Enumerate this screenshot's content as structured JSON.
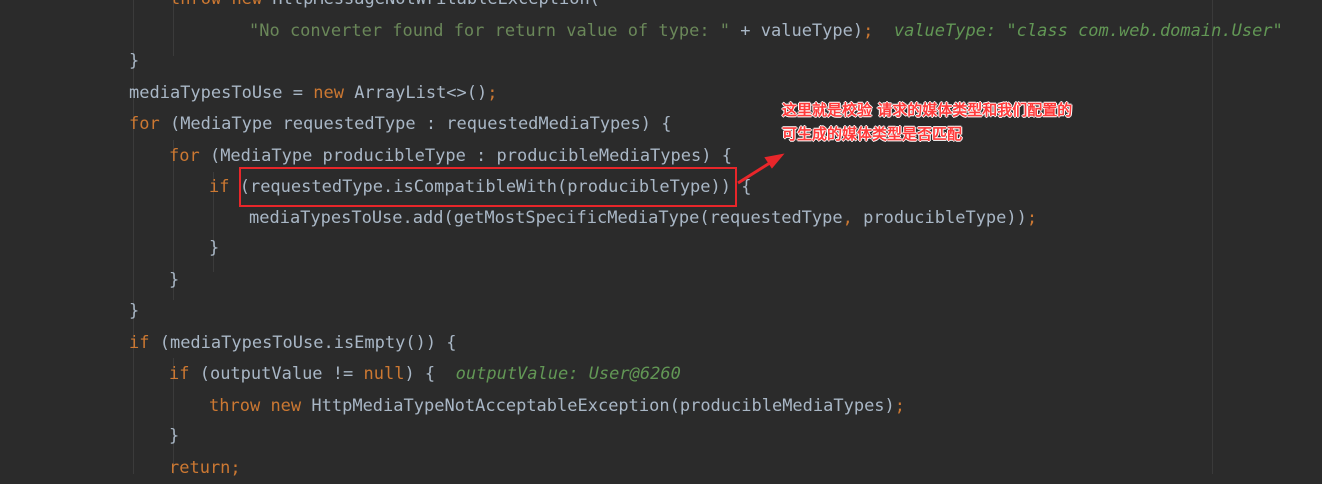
{
  "code": {
    "l0": {
      "kw1": "throw",
      "kw2": "new",
      "cls": "HttpMessageNotWritableException("
    },
    "l1": {
      "str": "\"No converter found for return value of type: \"",
      "plus": " + valueType)",
      "semi": ";",
      "hint": "valueType: \"class com.web.domain.User\""
    },
    "l2": {
      "brace": "}"
    },
    "l3": {
      "pre": "mediaTypesToUse = ",
      "kw": "new",
      "post": " ArrayList<>()",
      "semi": ";"
    },
    "l4": {
      "kw": "for",
      "rest": " (MediaType requestedType : requestedMediaTypes) {"
    },
    "l5": {
      "kw": "for",
      "rest": " (MediaType producibleType : producibleMediaTypes) {"
    },
    "l6": {
      "kw": "if",
      "rest": " (requestedType.isCompatibleWith(producibleType)) {"
    },
    "l7": {
      "pre": "mediaTypesToUse.add(getMostSpecificMediaType(requestedType",
      "comma": ",",
      "post": " producibleType))",
      "semi": ";"
    },
    "l8": {
      "brace": "}"
    },
    "l9": {
      "brace": "}"
    },
    "l10": {
      "brace": "}"
    },
    "l11": {
      "kw": "if",
      "rest": " (mediaTypesToUse.isEmpty()) {"
    },
    "l12": {
      "kw": "if",
      "pre": " (outputValue != ",
      "nul": "null",
      "post": ") {",
      "hint": "outputValue: User@6260"
    },
    "l13": {
      "kw1": "throw",
      "kw2": "new",
      "rest": " HttpMediaTypeNotAcceptableException(producibleMediaTypes)",
      "semi": ";"
    },
    "l14": {
      "brace": "}"
    },
    "l15": {
      "kw": "return",
      "semi": ";"
    }
  },
  "annotation": {
    "line1": "这里就是校验 请求的媒体类型和我们配置的",
    "line2": "可生成的媒体类型是否匹配"
  },
  "colors": {
    "background": "#2b2b2b",
    "keyword": "#cc7832",
    "string": "#6a8759",
    "plain": "#a9b7c6",
    "hint": "#629755",
    "annotation": "#e8262a"
  }
}
